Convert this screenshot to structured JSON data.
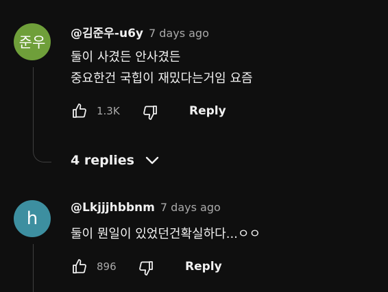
{
  "comments": [
    {
      "avatar_text": "준우",
      "avatar_color": "#6f9f3a",
      "author": "@김준우-u6y",
      "time": "7 days ago",
      "lines": [
        "둘이 사겼든 안사겼든",
        "중요한건 국힙이 재밌다는거임 요즘"
      ],
      "likes": "1.3K",
      "reply_label": "Reply"
    },
    {
      "avatar_text": "h",
      "avatar_color": "#3d8fa0",
      "author": "@Lkjjjhbbnm",
      "time": "7 days ago",
      "lines": [
        "둘이 뭔일이 있었던건확실하다...ㅇㅇ"
      ],
      "likes": "896",
      "reply_label": "Reply"
    }
  ],
  "replies_toggle": {
    "label": "4 replies",
    "icon": "chevron-down-icon"
  },
  "icons": {
    "like": "thumbs-up-icon",
    "dislike": "thumbs-down-icon"
  },
  "colors": {
    "background": "#0f0f0f",
    "text": "#f1f1f1",
    "muted": "#aaaaaa"
  }
}
